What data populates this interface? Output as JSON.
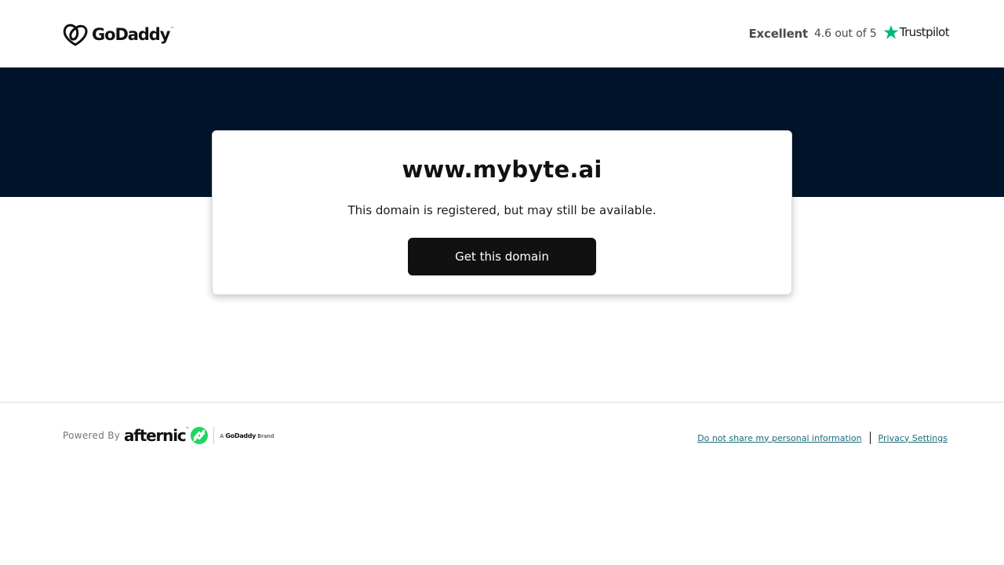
{
  "header": {
    "logo_text": "GoDaddy",
    "logo_tm": "™",
    "logo_icon": "godaddy-heart-icon",
    "trust": {
      "rating_word": "Excellent",
      "score_text": "4.6 out of 5",
      "star_icon": "star-icon",
      "brand": "Trustpilot",
      "star_color": "#00b67a"
    }
  },
  "hero": {
    "background": "#00142b"
  },
  "card": {
    "domain": "www.mybyte.ai",
    "subtitle": "This domain is registered, but may still be available.",
    "cta_label": "Get this domain"
  },
  "footer": {
    "powered_by": "Powered By",
    "afternic_text": "afternic",
    "afternic_tm": "™",
    "afternic_icon": "afternic-arrows-icon",
    "afternic_color": "#1ed760",
    "brand_note_prefix": "A",
    "brand_note_brand": "GoDaddy",
    "brand_note_suffix": "Brand",
    "links": [
      {
        "label": "Do not share my personal information"
      },
      {
        "label": "Privacy Settings"
      }
    ],
    "link_color": "#1a6a7a"
  }
}
